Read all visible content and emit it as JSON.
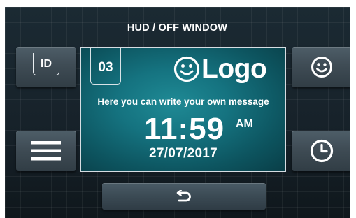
{
  "window": {
    "title": "HUD / OFF WINDOW"
  },
  "buttons": {
    "id": {
      "label": "ID",
      "icon": "id-badge-icon"
    },
    "menu": {
      "icon": "menu-icon"
    },
    "smiley": {
      "icon": "smiley-icon"
    },
    "clock": {
      "icon": "clock-icon"
    },
    "back": {
      "icon": "back-arrow-icon"
    }
  },
  "display": {
    "number": "03",
    "logo_text": "Logo",
    "logo_icon": "smiley-icon",
    "message": "Here you can write your own message",
    "time": "11:59",
    "ampm": "AM",
    "date": "27/07/2017"
  },
  "colors": {
    "background": "#17232b",
    "panel": "#157380",
    "button": "#3f4c55",
    "text": "#ffffff"
  }
}
